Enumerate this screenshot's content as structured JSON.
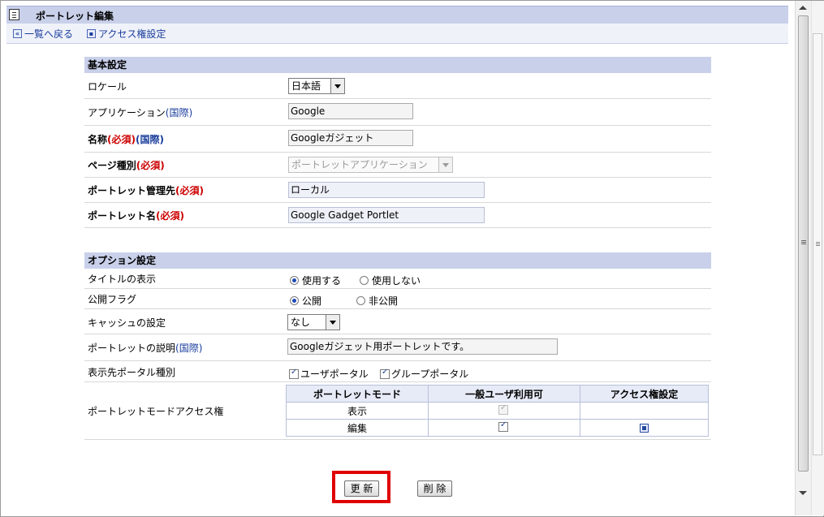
{
  "header": {
    "title": "ポートレット編集",
    "icon": "clipboard-icon"
  },
  "nav": {
    "back": {
      "label": "一覧へ戻る",
      "icon": "double-left-arrow-icon"
    },
    "access": {
      "label": "アクセス権設定",
      "icon": "access-settings-icon"
    }
  },
  "basic": {
    "title": "基本設定",
    "locale": {
      "label": "ロケール",
      "value": "日本語"
    },
    "application": {
      "label": "アプリケーション",
      "intl": "(国際)",
      "value": "Google"
    },
    "name": {
      "label": "名称",
      "required": "(必須)",
      "intl": "(国際)",
      "value": "Googleガジェット"
    },
    "page_type": {
      "label": "ページ種別",
      "required": "(必須)",
      "value": "ポートレットアプリケーション"
    },
    "manager": {
      "label": "ポートレット管理先",
      "required": "(必須)",
      "value": "ローカル"
    },
    "portlet_name": {
      "label": "ポートレット名",
      "required": "(必須)",
      "value": "Google Gadget Portlet"
    }
  },
  "options": {
    "title": "オプション設定",
    "title_display": {
      "label": "タイトルの表示",
      "opt_on": "使用する",
      "opt_off": "使用しない",
      "selected": "使用する"
    },
    "publish": {
      "label": "公開フラグ",
      "opt_on": "公開",
      "opt_off": "非公開",
      "selected": "公開"
    },
    "cache": {
      "label": "キャッシュの設定",
      "value": "なし"
    },
    "description": {
      "label": "ポートレットの説明",
      "intl": "(国際)",
      "value": "Googleガジェット用ポートレットです。"
    },
    "portal_type": {
      "label": "表示先ポータル種別",
      "user": "ユーザポータル",
      "group": "グループポータル",
      "user_checked": true,
      "group_checked": true
    },
    "mode_access": {
      "label": "ポートレットモードアクセス権",
      "headers": [
        "ポートレットモード",
        "一般ユーザ利用可",
        "アクセス権設定"
      ],
      "rows": [
        {
          "mode": "表示",
          "general_user": true,
          "general_disabled": true,
          "access_icon": false
        },
        {
          "mode": "編集",
          "general_user": true,
          "general_disabled": false,
          "access_icon": true
        }
      ]
    }
  },
  "buttons": {
    "update": "更 新",
    "delete": "削 除"
  },
  "colors": {
    "section_header": "#c9d0ea",
    "required": "#cc0000",
    "link": "#1a3d9c",
    "highlight": "#e00000"
  }
}
